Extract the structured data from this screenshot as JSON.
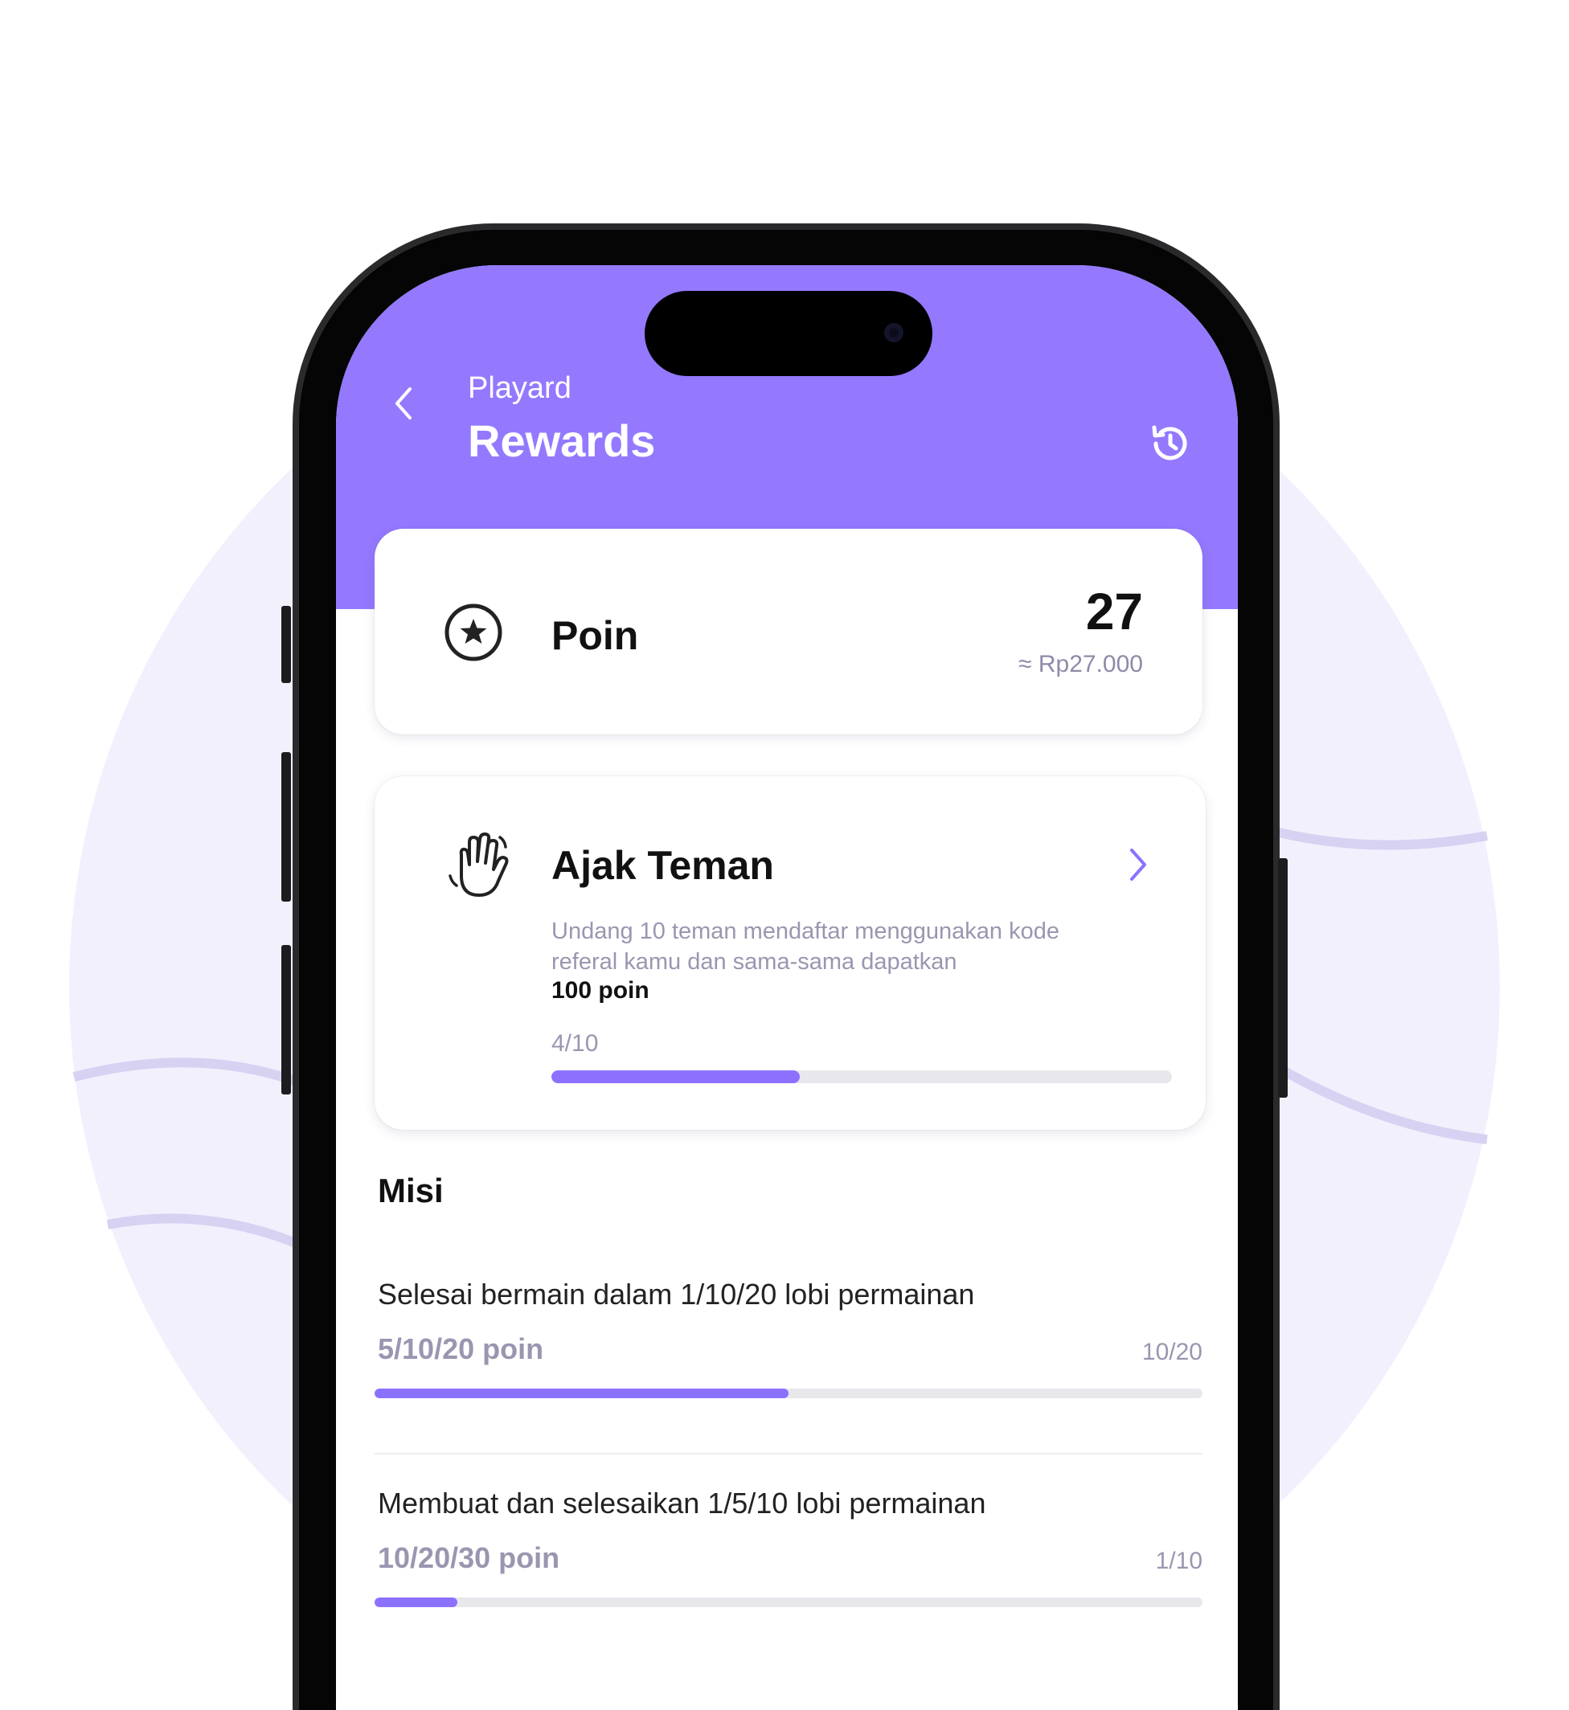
{
  "header": {
    "app_name": "Playard",
    "title": "Rewards"
  },
  "points": {
    "label": "Poin",
    "value": "27",
    "approx": "≈ Rp27.000"
  },
  "referral": {
    "title": "Ajak Teman",
    "description": "Undang 10 teman mendaftar menggunakan kode referal kamu dan sama-sama dapatkan",
    "reward": "100 poin",
    "progress_text": "4/10",
    "progress": 0.4
  },
  "missions": {
    "title": "Misi",
    "items": [
      {
        "title": "Selesai bermain dalam 1/10/20 lobi permainan",
        "reward": "5/10/20 poin",
        "count": "10/20",
        "progress": 0.5
      },
      {
        "title": "Membuat dan selesaikan 1/5/10 lobi permainan",
        "reward": "10/20/30 poin",
        "count": "1/10",
        "progress": 0.1
      }
    ]
  },
  "colors": {
    "accent": "#9479ff",
    "progress_fill": "#8c71ff",
    "muted_text": "#9a96b0",
    "background_circle": "#f2f0fd"
  },
  "icons": {
    "back": "chevron-left-icon",
    "history": "history-icon",
    "points": "star-circle-icon",
    "referral": "waving-hand-icon",
    "referral_open": "chevron-right-icon"
  }
}
